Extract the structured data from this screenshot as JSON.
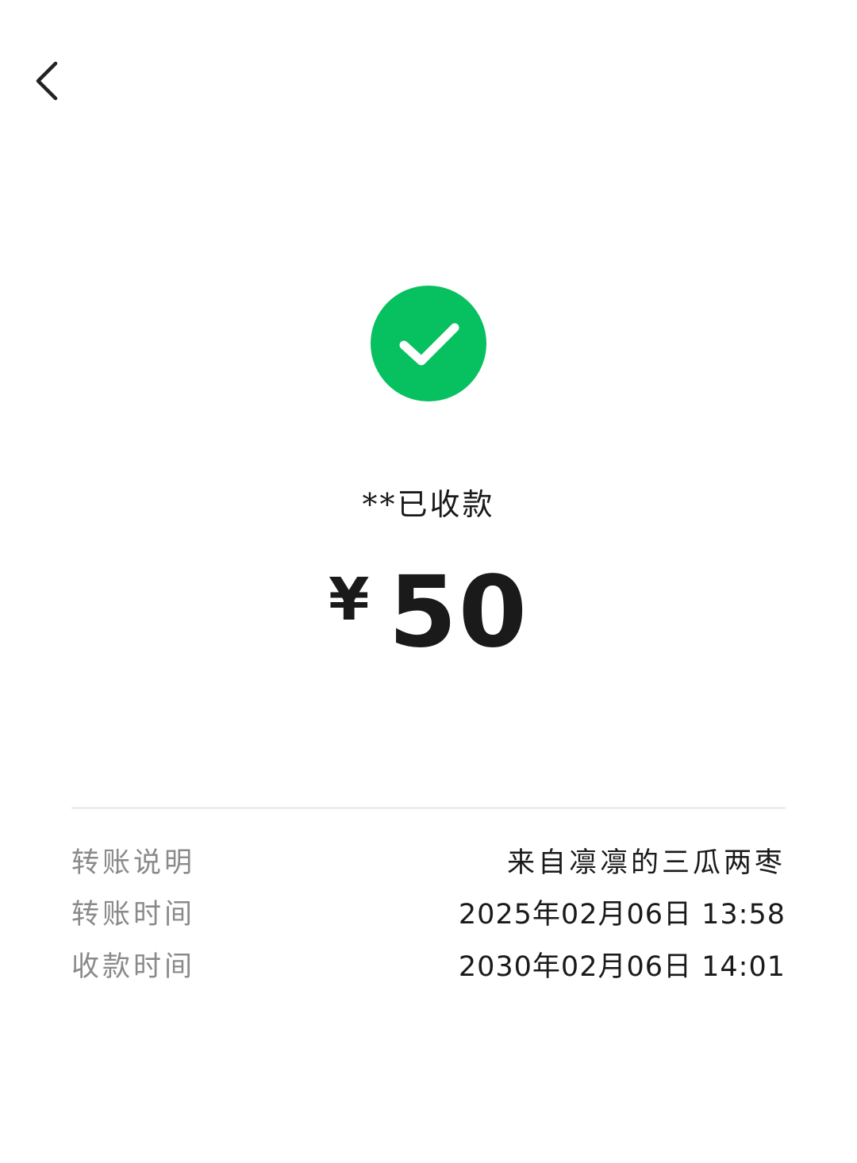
{
  "nav": {
    "back_icon": "chevron-left-icon"
  },
  "status": {
    "icon": "check-circle-icon",
    "icon_color": "#07C160",
    "text": "**已收款"
  },
  "amount": {
    "currency": "¥",
    "value": "50"
  },
  "details": [
    {
      "label": "转账说明",
      "value": "来自凛凛的三瓜两枣"
    },
    {
      "label": "转账时间",
      "value": "2025年02月06日 13:58"
    },
    {
      "label": "收款时间",
      "value": "2030年02月06日 14:01"
    }
  ]
}
